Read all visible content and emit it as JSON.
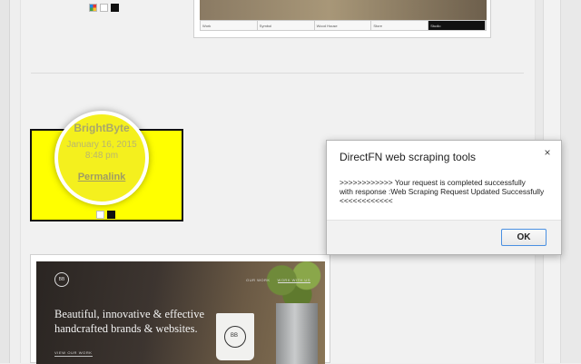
{
  "top_card": {
    "nav_items": [
      "Work",
      "Symbol",
      "Wood House",
      "Store",
      "Studio"
    ]
  },
  "yellow_card": {
    "brand": "BrightByte",
    "date": "January 16, 2015",
    "time": "8:48 pm",
    "permalink": "Permalink"
  },
  "bottom_card": {
    "logo": "BB",
    "nav_links": [
      "OUR WORK",
      "WORK WITH US"
    ],
    "headline_line1": "Beautiful, innovative & effective",
    "headline_line2": "handcrafted brands & websites.",
    "cta": "VIEW OUR WORK",
    "cup_logo": "BB"
  },
  "dialog": {
    "title": "DirectFN web scraping tools",
    "close_label": "×",
    "message_line1": ">>>>>>>>>>>> Your request is completed successfully",
    "message_line2": "with response :Web Scraping Request Updated Successfully",
    "message_line3": "<<<<<<<<<<<<",
    "ok_label": "OK"
  },
  "colors": {
    "card_highlight": "#ffff00",
    "ok_border": "#4a90e2"
  },
  "icons": {
    "swatch_color": "color-swatch-icon",
    "swatch_white": "white-swatch-icon",
    "swatch_black": "black-swatch-icon"
  }
}
